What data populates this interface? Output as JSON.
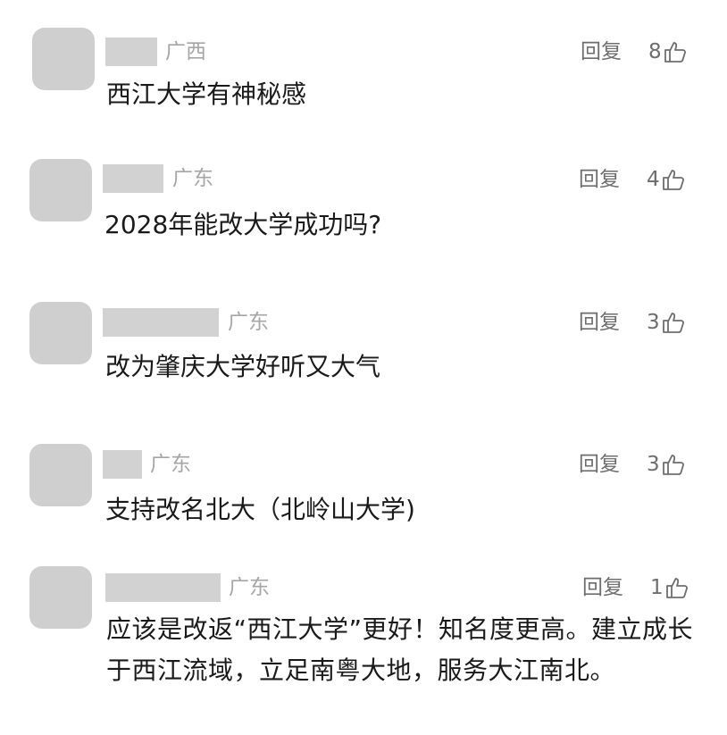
{
  "icons": {
    "avatar": "avatar-placeholder",
    "like": "thumbs-up-outline-icon"
  },
  "colors": {
    "avatar": "#cfcfcf",
    "name_mask": "#d2d2d2",
    "meta": "#a6a6a6",
    "action": "#6e6e6e",
    "text": "#1a1a1a"
  },
  "comments": [
    {
      "location": "广西",
      "reply_label": "回复",
      "likes": "8",
      "text": "西江大学有神秘感"
    },
    {
      "location": "广东",
      "reply_label": "回复",
      "likes": "4",
      "text": "2028年能改大学成功吗?"
    },
    {
      "location": "广东",
      "reply_label": "回复",
      "likes": "3",
      "text": "改为肇庆大学好听又大气"
    },
    {
      "location": "广东",
      "reply_label": "回复",
      "likes": "3",
      "text": "支持改名北大（北岭山大学)"
    },
    {
      "location": "广东",
      "reply_label": "回复",
      "likes": "1",
      "text": "应该是改返“西江大学”更好！知名度更高。建立成长于西江流域，立足南粤大地，服务大江南北。"
    }
  ]
}
